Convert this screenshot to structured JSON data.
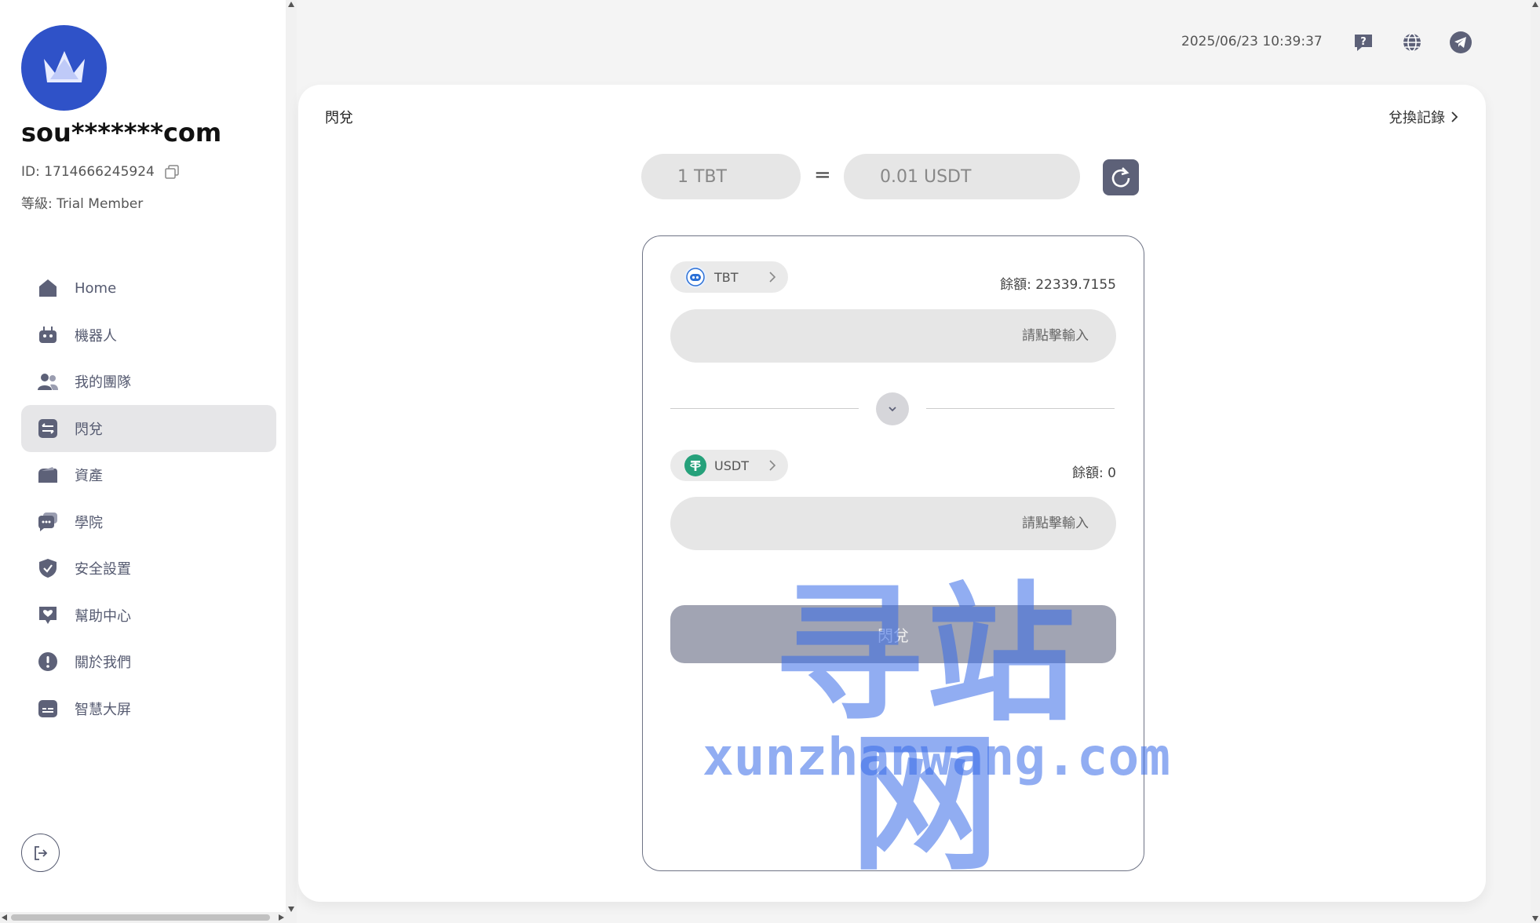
{
  "user": {
    "name": "sou*******com",
    "id_label": "ID: 1714666245924",
    "level_label": "等級: Trial Member"
  },
  "sidebar": {
    "items": [
      {
        "label": "Home",
        "icon": "home-icon"
      },
      {
        "label": "機器人",
        "icon": "robot-icon"
      },
      {
        "label": "我的團隊",
        "icon": "team-icon"
      },
      {
        "label": "閃兌",
        "icon": "swap-icon",
        "active": true
      },
      {
        "label": "資產",
        "icon": "wallet-icon"
      },
      {
        "label": "學院",
        "icon": "academy-icon"
      },
      {
        "label": "安全設置",
        "icon": "shield-icon"
      },
      {
        "label": "幫助中心",
        "icon": "help-heart-icon"
      },
      {
        "label": "關於我們",
        "icon": "info-icon"
      },
      {
        "label": "智慧大屏",
        "icon": "screen-icon"
      }
    ]
  },
  "header": {
    "datetime": "2025/06/23 10:39:37",
    "icons": [
      "help-chat-icon",
      "globe-icon",
      "telegram-icon"
    ]
  },
  "main": {
    "title": "閃兌",
    "history_link": "兌換記錄",
    "rate": {
      "from": "1 TBT",
      "equals": "=",
      "to": "0.01 USDT"
    },
    "from_token": {
      "symbol": "TBT",
      "balance": "餘額: 22339.7155",
      "placeholder": "請點擊輸入"
    },
    "to_token": {
      "symbol": "USDT",
      "balance": "餘額: 0",
      "placeholder": "請點擊輸入"
    },
    "submit_label": "閃兌"
  },
  "watermark": {
    "cn": "寻站网",
    "en": "xunzhanwang.com"
  },
  "colors": {
    "accent": "#5d6178",
    "avatar": "#2f52c8",
    "tbt": "#2a6fd6",
    "usdt": "#26a17b",
    "watermark": "#3669e8"
  }
}
